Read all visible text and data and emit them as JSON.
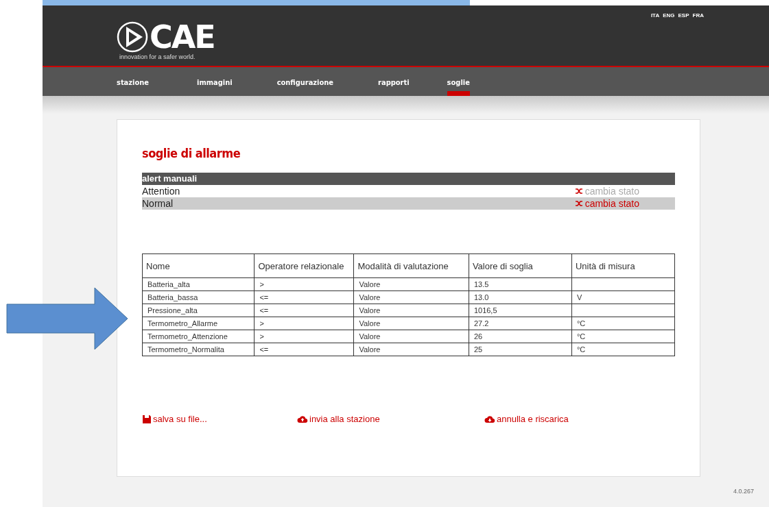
{
  "header": {
    "logo_text": "CAE",
    "tagline": "innovation for a safer world.",
    "languages": [
      "ITA",
      "ENG",
      "ESP",
      "FRA"
    ]
  },
  "nav": [
    {
      "label": "stazione",
      "selected": false
    },
    {
      "label": "immagini",
      "selected": false
    },
    {
      "label": "configurazione",
      "selected": false
    },
    {
      "label": "rapporti",
      "selected": false
    },
    {
      "label": "soglie",
      "selected": true
    }
  ],
  "title": "soglie di allarme",
  "alerts": {
    "heading": "alert manuali",
    "rows": [
      {
        "name": "Attention",
        "action": "cambia stato",
        "disabled": true
      },
      {
        "name": "Normal",
        "action": "cambia stato",
        "disabled": false
      }
    ]
  },
  "table": {
    "columns": [
      "Nome",
      "Operatore relazionale",
      "Modalità di valutazione",
      "Valore di soglia",
      "Unità di misura"
    ],
    "rows": [
      [
        "Batteria_alta",
        ">",
        "Valore",
        "13.5",
        ""
      ],
      [
        "Batteria_bassa",
        "<=",
        "Valore",
        "13.0",
        "V"
      ],
      [
        "Pressione_alta",
        "<=",
        "Valore",
        "1016,5",
        ""
      ],
      [
        "Termometro_Allarme",
        ">",
        "Valore",
        "27.2",
        "°C"
      ],
      [
        "Termometro_Attenzione",
        ">",
        "Valore",
        "26",
        "°C"
      ],
      [
        "Termometro_Normalita",
        "<=",
        "Valore",
        "25",
        "°C"
      ]
    ]
  },
  "actions": [
    {
      "kind": "save",
      "label": "salva su file..."
    },
    {
      "kind": "upload",
      "label": "invia alla stazione"
    },
    {
      "kind": "reload",
      "label": "annulla e riscarica"
    }
  ],
  "version": "4.0.267"
}
